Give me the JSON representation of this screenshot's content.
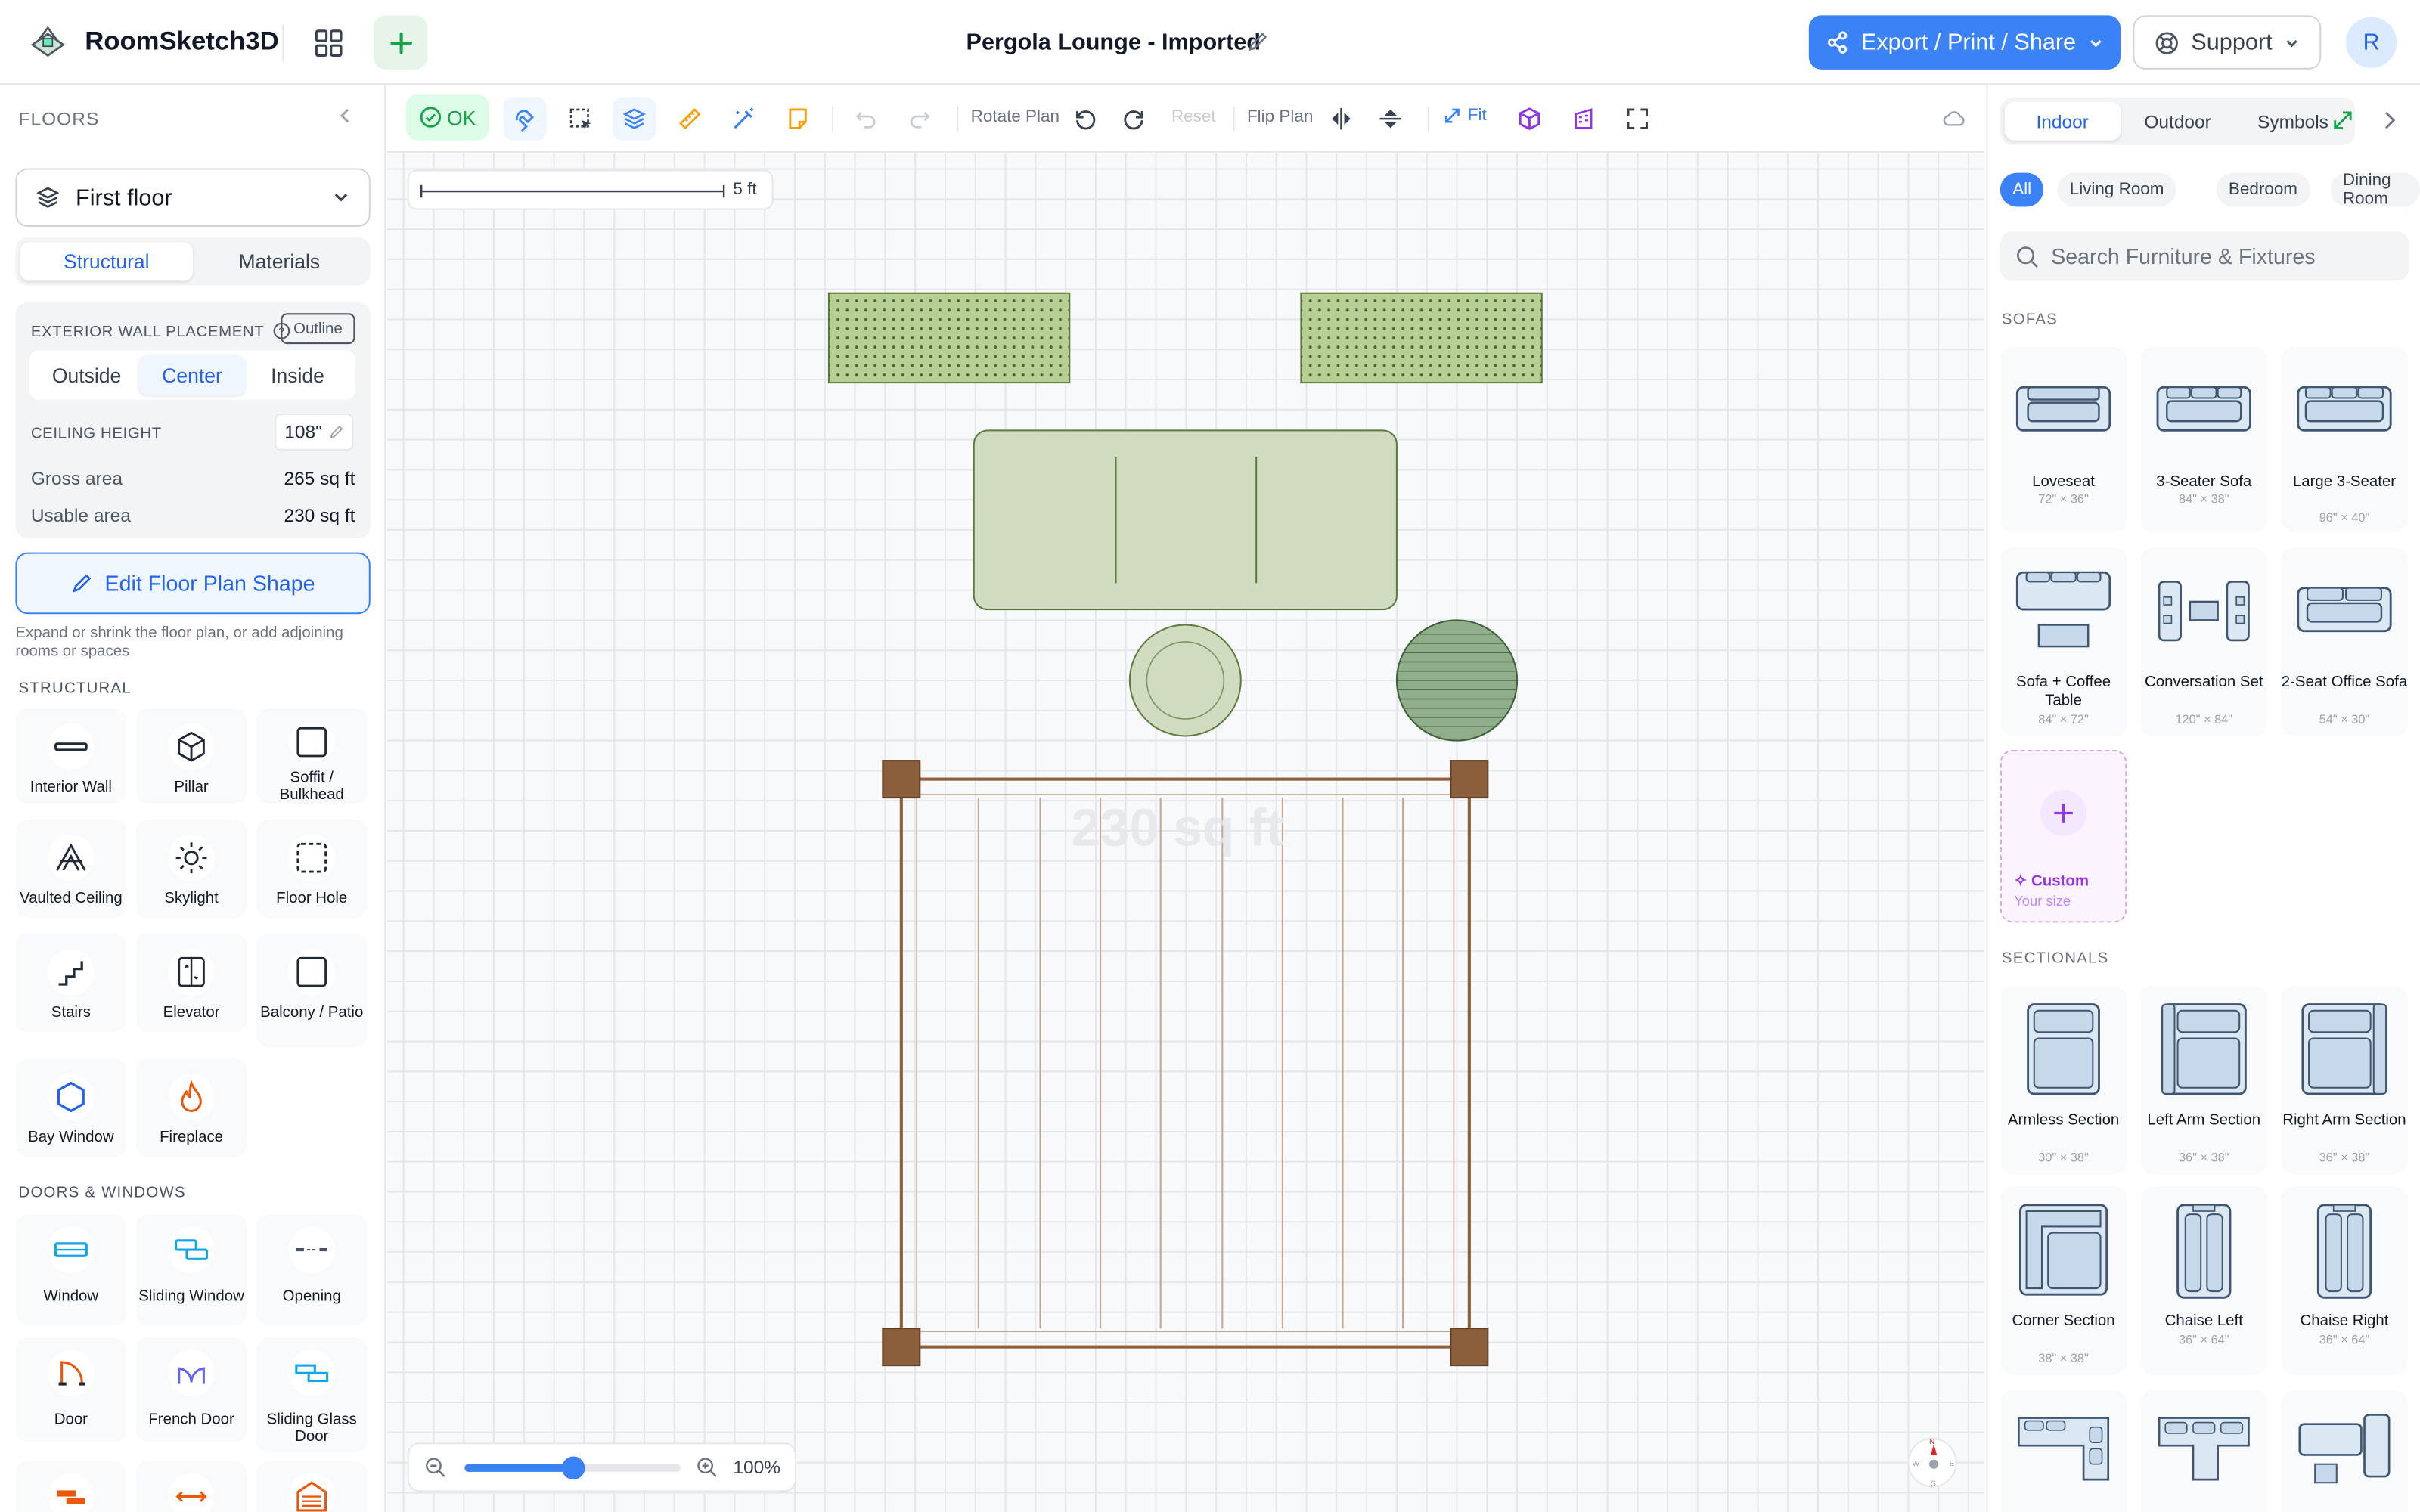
{
  "app": {
    "name": "RoomSketch3D",
    "project_title": "Pergola Lounge - Imported"
  },
  "header": {
    "export_label": "Export / Print / Share",
    "support_label": "Support",
    "avatar_initial": "R"
  },
  "floors": {
    "title": "FLOORS",
    "selected_floor": "First floor",
    "tabs": [
      "Structural",
      "Materials"
    ],
    "exterior_wall_label": "EXTERIOR WALL PLACEMENT",
    "outline_label": "Outline",
    "placement_options": [
      "Outside",
      "Center",
      "Inside"
    ],
    "ceiling_height_label": "CEILING HEIGHT",
    "ceiling_height_value": "108\"",
    "gross_area_label": "Gross area",
    "gross_area_value": "265 sq ft",
    "usable_area_label": "Usable area",
    "usable_area_value": "230 sq ft",
    "edit_shape_label": "Edit Floor Plan Shape",
    "edit_shape_hint": "Expand or shrink the floor plan, or add adjoining rooms or spaces"
  },
  "structural": {
    "heading": "STRUCTURAL",
    "items": [
      "Interior Wall",
      "Pillar",
      "Soffit / Bulkhead",
      "Vaulted Ceiling",
      "Skylight",
      "Floor Hole",
      "Stairs",
      "Elevator",
      "Balcony / Patio",
      "Bay Window",
      "Fireplace"
    ]
  },
  "doors_windows": {
    "heading": "DOORS & WINDOWS",
    "items": [
      "Window",
      "Sliding Window",
      "Opening",
      "Door",
      "French Door",
      "Sliding Glass Door"
    ]
  },
  "toolbar": {
    "ok_label": "OK",
    "rotate_label": "Rotate Plan",
    "reset_label": "Reset",
    "flip_label": "Flip Plan",
    "fit_label": "Fit"
  },
  "canvas": {
    "scale_label": "5 ft",
    "area_watermark": "230 sq ft",
    "zoom_value": "100%",
    "zoom_level": 0.5,
    "compass": {
      "n": "N",
      "w": "W",
      "e": "E",
      "s": "S"
    }
  },
  "catalog": {
    "tabs": [
      "Indoor",
      "Outdoor",
      "Symbols"
    ],
    "chips": [
      "All",
      "Living Room",
      "Bedroom",
      "Dining Room"
    ],
    "search_placeholder": "Search Furniture & Fixtures",
    "sofas_heading": "SOFAS",
    "sofas": [
      {
        "name": "Loveseat",
        "size": "72\" × 36\""
      },
      {
        "name": "3-Seater Sofa",
        "size": "84\" × 38\""
      },
      {
        "name": "Large 3-Seater",
        "size": "96\" × 40\""
      },
      {
        "name": "Sofa + Coffee Table",
        "size": "84\" × 72\""
      },
      {
        "name": "Conversation Set",
        "size": "120\" × 84\""
      },
      {
        "name": "2-Seat Office Sofa",
        "size": "54\" × 30\""
      }
    ],
    "custom_label": "Custom",
    "custom_sub": "Your size",
    "sectionals_heading": "SECTIONALS",
    "sectionals": [
      {
        "name": "Armless Section",
        "size": "30\" × 38\""
      },
      {
        "name": "Left Arm Section",
        "size": "36\" × 38\""
      },
      {
        "name": "Right Arm Section",
        "size": "36\" × 38\""
      },
      {
        "name": "Corner Section",
        "size": "38\" × 38\""
      },
      {
        "name": "Chaise Left",
        "size": "36\" × 64\""
      },
      {
        "name": "Chaise Right",
        "size": "36\" × 64\""
      }
    ]
  },
  "colors": {
    "accent": "#3b82f6",
    "ok_green": "#16a34a",
    "pergola_brown": "#8b5e3c",
    "cushion_green": "#d0dbbf"
  }
}
